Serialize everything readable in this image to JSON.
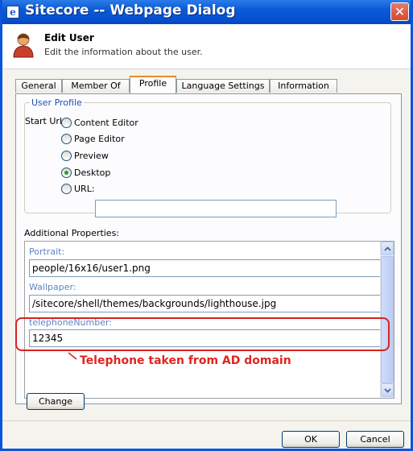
{
  "window": {
    "title": "Sitecore -- Webpage Dialog",
    "close_label": "✕"
  },
  "header": {
    "title": "Edit User",
    "subtitle": "Edit the information about the user."
  },
  "tabs": [
    {
      "label": "General"
    },
    {
      "label": "Member Of"
    },
    {
      "label": "Profile"
    },
    {
      "label": "Language Settings"
    },
    {
      "label": "Information"
    }
  ],
  "active_tab": "Profile",
  "profile": {
    "legend": "User Profile",
    "start_url_label": "Start Url:",
    "options": [
      {
        "label": "Content Editor",
        "checked": false
      },
      {
        "label": "Page Editor",
        "checked": false
      },
      {
        "label": "Preview",
        "checked": false
      },
      {
        "label": "Desktop",
        "checked": true
      },
      {
        "label": "URL:",
        "checked": false
      }
    ],
    "url_value": ""
  },
  "additional": {
    "label": "Additional Properties:",
    "properties": [
      {
        "label": "Portrait:",
        "value": "people/16x16/user1.png"
      },
      {
        "label": "Wallpaper:",
        "value": "/sitecore/shell/themes/backgrounds/lighthouse.jpg"
      },
      {
        "label": "telephoneNumber:",
        "value": "12345"
      }
    ]
  },
  "annotation": {
    "text": "Telephone taken from AD domain",
    "color": "#e0251e"
  },
  "buttons": {
    "change": "Change",
    "ok": "OK",
    "cancel": "Cancel"
  },
  "colors": {
    "titlebar": "#0a5ad6",
    "legend": "#1f4fb6",
    "property_label": "#5e84c7"
  }
}
